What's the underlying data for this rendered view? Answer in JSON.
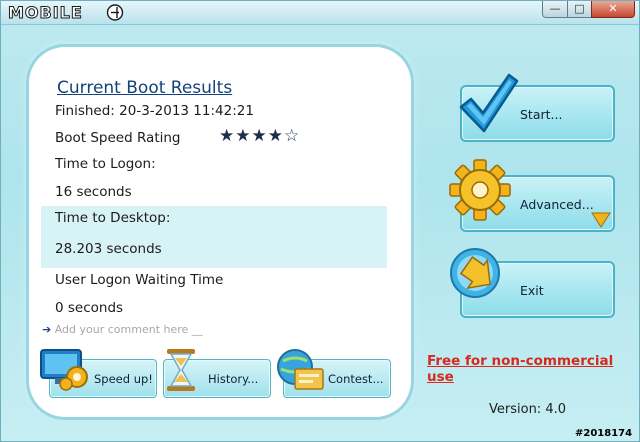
{
  "app": {
    "logo_text": "MOBILE01"
  },
  "window_controls": {
    "minimize": "—",
    "maximize": "□",
    "close": "✕"
  },
  "results": {
    "title": "Current Boot Results",
    "finished": "Finished: 20-3-2013 11:42:21",
    "boot_speed_label": "Boot Speed Rating",
    "boot_speed_stars": "★★★★☆",
    "boot_speed_rating": 4,
    "logon_label": "Time to Logon:",
    "logon_value": "16 seconds",
    "desktop_label": "Time to Desktop:",
    "desktop_value": "28.203 seconds",
    "waiting_label": "User Logon Waiting Time",
    "waiting_value": "0 seconds",
    "comment_placeholder": "Add your comment here __"
  },
  "bottom_buttons": {
    "speedup": "Speed up!",
    "history": "History...",
    "contest": "Contest..."
  },
  "side_buttons": {
    "start": "Start...",
    "advanced": "Advanced...",
    "exit": "Exit"
  },
  "footer": {
    "license": "Free for non-commercial use",
    "version": "Version: 4.0",
    "watermark": "#2018174"
  },
  "colors": {
    "accent": "#13437a",
    "license_red": "#d62a1e",
    "highlight": "#d7f3f6"
  },
  "icons": [
    "checkmark-icon",
    "gear-icon",
    "exit-arrow-icon",
    "monitor-gear-icon",
    "hourglass-icon",
    "globe-card-icon",
    "arrow-right-icon",
    "dropdown-triangle-icon"
  ]
}
